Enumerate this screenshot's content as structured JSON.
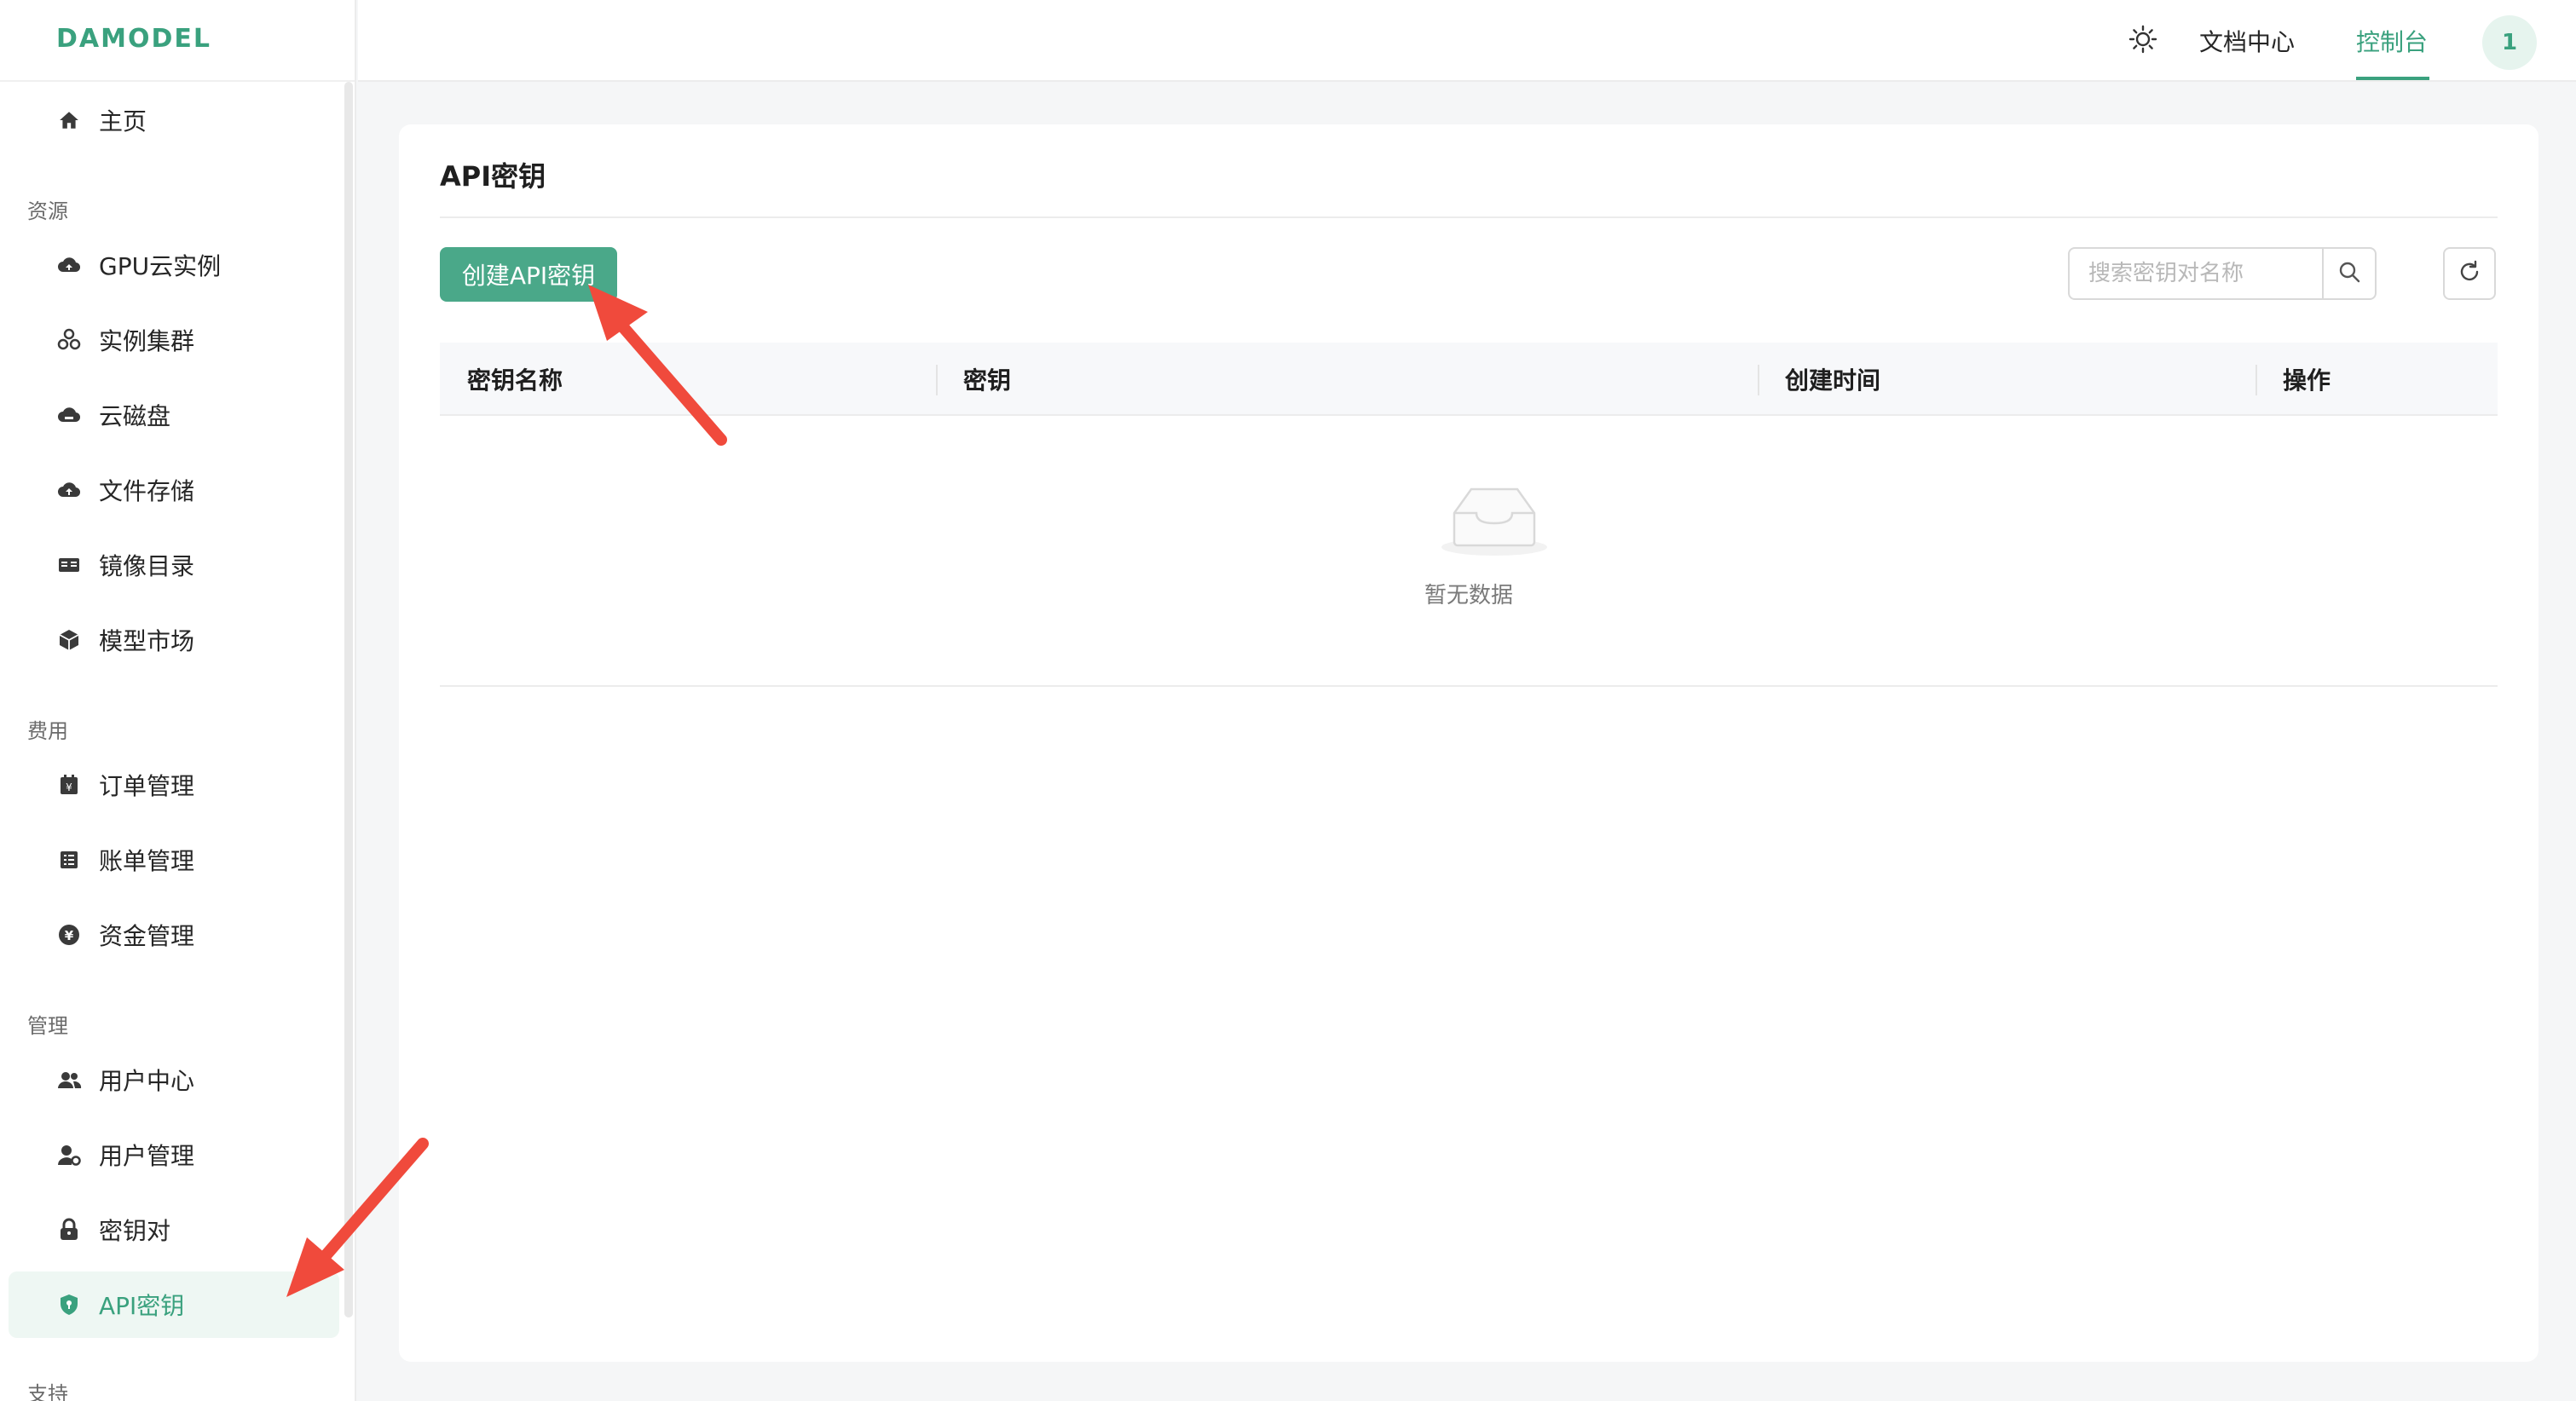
{
  "app": {
    "logo": "DAMODEL"
  },
  "header": {
    "docs_label": "文档中心",
    "console_label": "控制台",
    "avatar_text": "1",
    "accent_color": "#3aa17e"
  },
  "sidebar": {
    "home": {
      "label": "主页",
      "icon": "home-icon"
    },
    "sections": {
      "resources": "资源",
      "billing": "费用",
      "management": "管理",
      "support": "支持"
    },
    "items": [
      {
        "label": "GPU云实例",
        "icon": "cloud-icon"
      },
      {
        "label": "实例集群",
        "icon": "cluster-icon"
      },
      {
        "label": "云磁盘",
        "icon": "cloud-disk-icon"
      },
      {
        "label": "文件存储",
        "icon": "cloud-upload-icon"
      },
      {
        "label": "镜像目录",
        "icon": "book-icon"
      },
      {
        "label": "模型市场",
        "icon": "cube-icon"
      },
      {
        "label": "订单管理",
        "icon": "order-icon"
      },
      {
        "label": "账单管理",
        "icon": "bill-icon"
      },
      {
        "label": "资金管理",
        "icon": "yuan-icon"
      },
      {
        "label": "用户中心",
        "icon": "users-icon"
      },
      {
        "label": "用户管理",
        "icon": "user-settings-icon"
      },
      {
        "label": "密钥对",
        "icon": "lock-icon"
      },
      {
        "label": "API密钥",
        "icon": "shield-icon",
        "active": true
      }
    ]
  },
  "main": {
    "title": "API密钥",
    "create_button": "创建API密钥",
    "search_placeholder": "搜索密钥对名称",
    "table": {
      "columns": [
        "密钥名称",
        "密钥",
        "创建时间",
        "操作"
      ],
      "rows": []
    },
    "empty_text": "暂无数据"
  }
}
